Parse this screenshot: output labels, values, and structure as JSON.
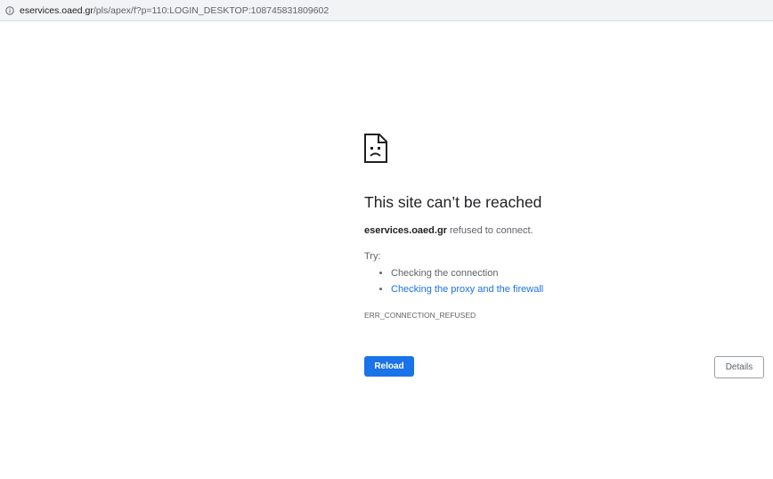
{
  "address_bar": {
    "icon": "info-icon",
    "url_host": "eservices.oaed.gr",
    "url_path": "/pls/apex/f?p=110:LOGIN_DESKTOP:108745831809602"
  },
  "error": {
    "icon": "sad-document-icon",
    "title": "This site can’t be reached",
    "host": "eservices.oaed.gr",
    "message_suffix": " refused to connect.",
    "try_label": "Try:",
    "suggestions": [
      "Checking the connection",
      "Checking the proxy and the firewall"
    ],
    "code": "ERR_CONNECTION_REFUSED"
  },
  "buttons": {
    "reload": "Reload",
    "details": "Details"
  },
  "colors": {
    "link": "#1a73e8",
    "primary_button": "#1a73e8",
    "text_secondary": "#5f6368",
    "text_primary": "#202124"
  }
}
